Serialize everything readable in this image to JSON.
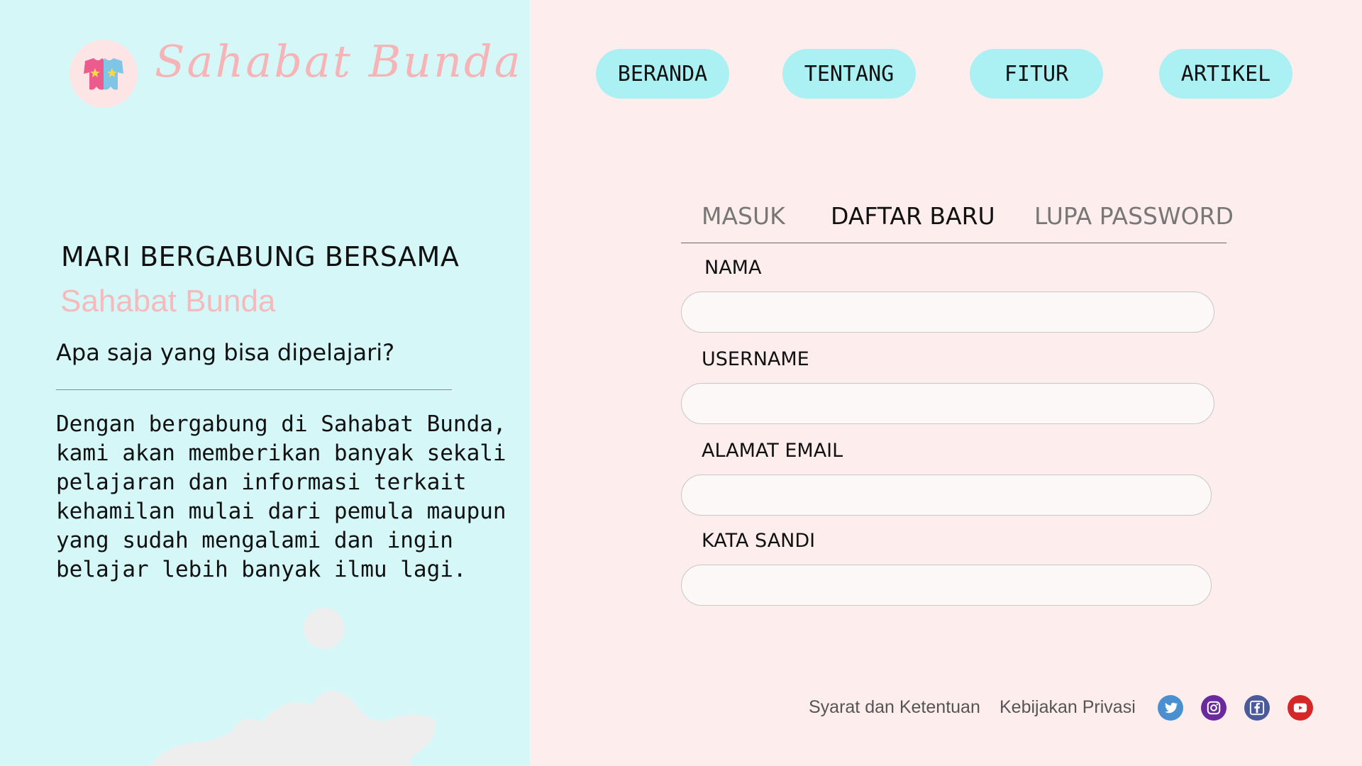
{
  "brand": {
    "name": "Sahabat Bunda",
    "colors": {
      "left_bg": "#d5f7f8",
      "right_bg": "#fdeeed",
      "accent_pink": "#f6b4b6",
      "nav_button": "#abf0f3"
    }
  },
  "nav": {
    "items": [
      {
        "label": "BERANDA"
      },
      {
        "label": "TENTANG"
      },
      {
        "label": "FITUR"
      },
      {
        "label": "ARTIKEL"
      }
    ]
  },
  "intro": {
    "heading": "MARI BERGABUNG BERSAMA",
    "subheading": "Sahabat Bunda",
    "question": "Apa saja yang bisa dipelajari?",
    "description": "Dengan bergabung di Sahabat Bunda, kami akan memberikan banyak sekali pelajaran dan informasi terkait kehamilan mulai dari pemula maupun yang sudah mengalami dan ingin belajar lebih banyak ilmu lagi."
  },
  "form": {
    "tabs": [
      {
        "label": "MASUK",
        "active": false
      },
      {
        "label": "DAFTAR BARU",
        "active": true
      },
      {
        "label": "LUPA PASSWORD",
        "active": false
      }
    ],
    "fields": [
      {
        "label": "NAMA",
        "value": ""
      },
      {
        "label": "USERNAME",
        "value": ""
      },
      {
        "label": "ALAMAT EMAIL",
        "value": ""
      },
      {
        "label": "KATA SANDI",
        "value": ""
      }
    ]
  },
  "footer": {
    "links": [
      "Syarat dan Ketentuan",
      "Kebijakan Privasi"
    ],
    "social": [
      {
        "icon": "twitter-icon",
        "color": "#4a8fd0"
      },
      {
        "icon": "instagram-icon",
        "color": "#6a2a9c"
      },
      {
        "icon": "facebook-icon",
        "color": "#4a5a9a"
      },
      {
        "icon": "youtube-icon",
        "color": "#d42828"
      }
    ]
  }
}
